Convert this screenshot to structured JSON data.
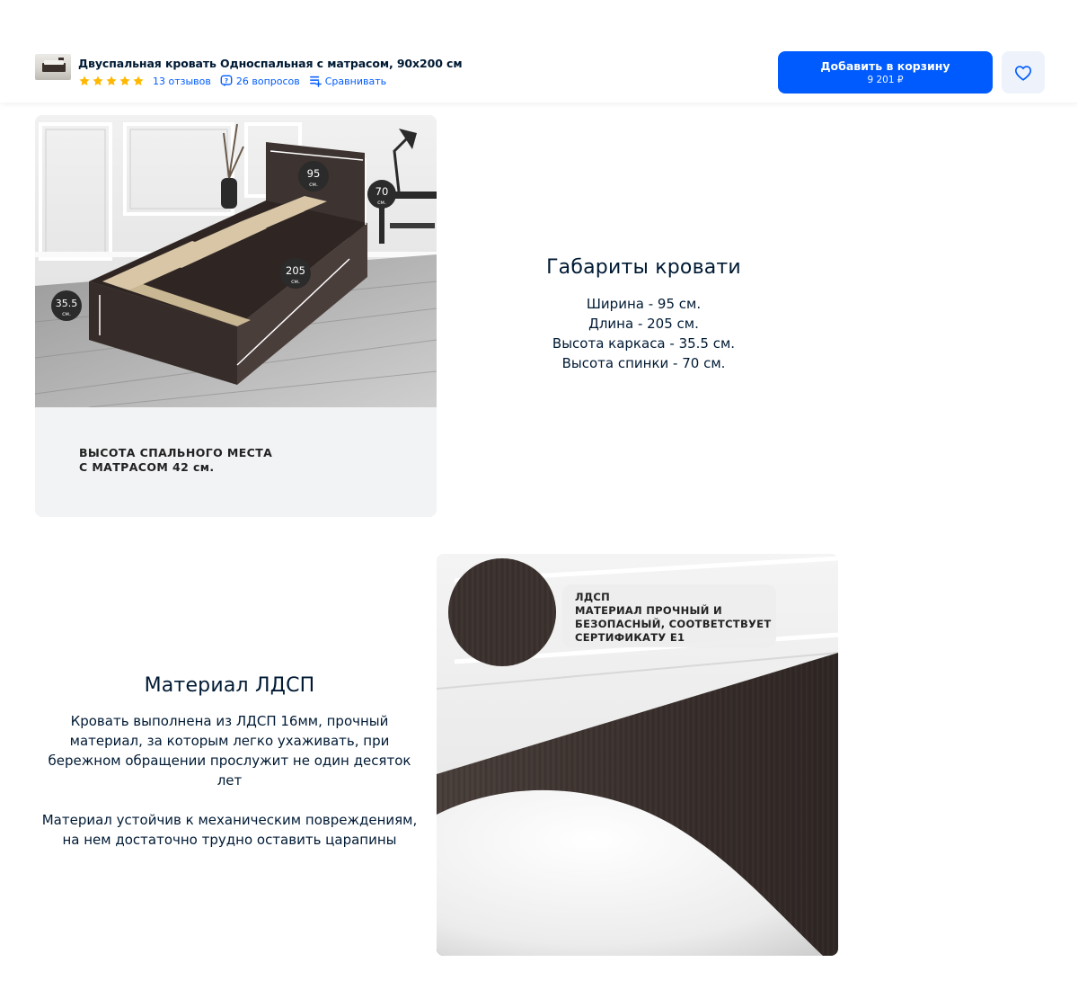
{
  "header": {
    "product_title": "Двуспальная кровать Односпальная с матрасом, 90x200 см",
    "rating_stars": 5,
    "reviews": "13 отзывов",
    "questions": "26 вопросов",
    "compare": "Сравнивать",
    "cart_label": "Добавить в корзину",
    "price": "9 201 ₽"
  },
  "dimensions_block": {
    "image_labels": [
      "95",
      "см.",
      "70",
      "см.",
      "205",
      "см.",
      "35.5",
      "см."
    ],
    "caption": "ВЫСОТА СПАЛЬНОГО МЕСТА\nС МАТРАСОМ 42 см.",
    "heading": "Габариты кровати",
    "lines": [
      "Ширина - 95 см.",
      "Длина - 205 см.",
      "Высота каркаса - 35.5 см.",
      "Высота спинки - 70 см."
    ]
  },
  "material_block": {
    "heading": "Материал ЛДСП",
    "paragraph1": "Кровать выполнена из ЛДСП 16мм, прочный материал, за которым легко ухаживать, при бережном обращении прослужит не один десяток лет",
    "paragraph2": "Материал устойчив к механическим повреждениям, на нем достаточно трудно оставить царапины",
    "badge_title": "ЛДСП",
    "badge_text1": "МАТЕРИАЛ ПРОЧНЫЙ И",
    "badge_text2": "БЕЗОПАСНЫЙ, СООТВЕТСТВУЕТ",
    "badge_text3": "СЕРТИФИКАТУ Е1"
  },
  "colors": {
    "accent": "#005bff",
    "text": "#001a34",
    "star": "#ffb800",
    "wood": "#3d3330"
  }
}
